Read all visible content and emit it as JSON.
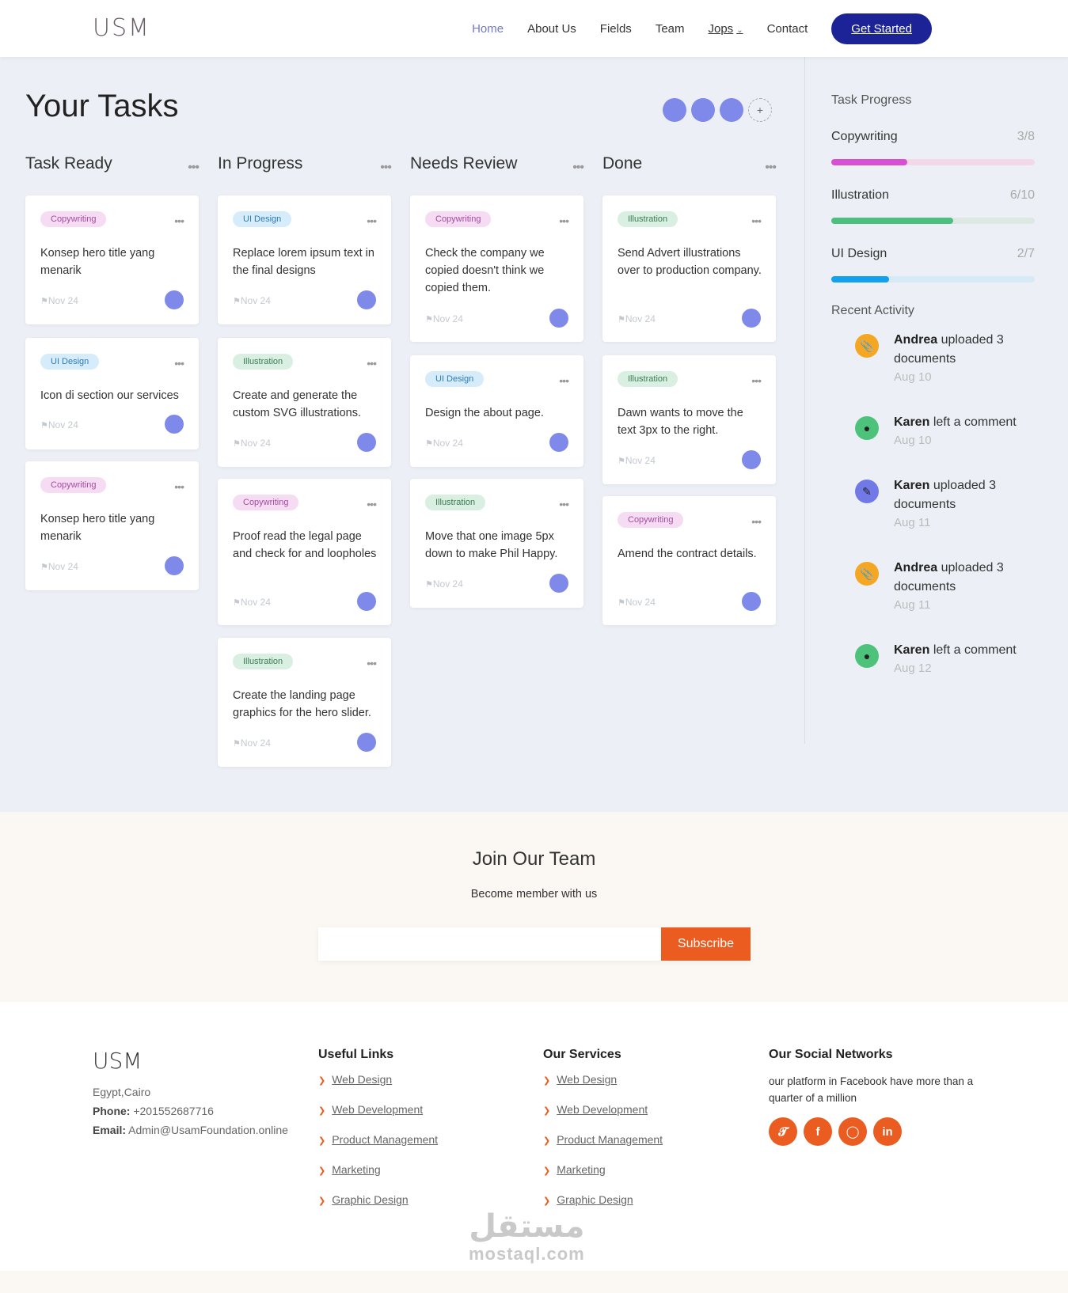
{
  "header": {
    "logo": "USM",
    "nav": [
      "Home",
      "About Us",
      "Fields",
      "Team",
      "Jops",
      "Contact"
    ],
    "cta": "Get Started"
  },
  "tasks": {
    "title": "Your Tasks",
    "add_symbol": "+",
    "columns": [
      {
        "title": "Task Ready",
        "cards": [
          {
            "tag": "Copywriting",
            "text": "Konsep hero title yang menarik",
            "date": "Nov 24"
          },
          {
            "tag": "UI Design",
            "text": "Icon di section our services",
            "date": "Nov 24"
          },
          {
            "tag": "Copywriting",
            "text": "Konsep hero title yang menarik",
            "date": "Nov 24"
          }
        ]
      },
      {
        "title": "In Progress",
        "cards": [
          {
            "tag": "UI Design",
            "text": "Replace lorem ipsum text in the final designs",
            "date": "Nov 24"
          },
          {
            "tag": "Illustration",
            "text": "Create and generate the custom SVG illustrations.",
            "date": "Nov 24"
          },
          {
            "tag": "Copywriting",
            "text": "Proof read the legal page and check for and loopholes",
            "date": "Nov 24"
          },
          {
            "tag": "Illustration",
            "text": "Create the landing page graphics for the hero slider.",
            "date": "Nov 24"
          }
        ]
      },
      {
        "title": "Needs Review",
        "cards": [
          {
            "tag": "Copywriting",
            "text": "Check the company we copied doesn't think we copied them.",
            "date": "Nov 24"
          },
          {
            "tag": "UI Design",
            "text": "Design the about page.",
            "date": "Nov 24"
          },
          {
            "tag": "Illustration",
            "text": "Move that one image 5px down to make Phil Happy.",
            "date": "Nov 24"
          }
        ]
      },
      {
        "title": "Done",
        "cards": [
          {
            "tag": "Illustration",
            "text": "Send Advert illustrations over to production company.",
            "date": "Nov 24"
          },
          {
            "tag": "Illustration",
            "text": "Dawn wants to move the text 3px to the right.",
            "date": "Nov 24"
          },
          {
            "tag": "Copywriting",
            "text": "Amend the contract details.",
            "date": "Nov 24"
          }
        ]
      }
    ]
  },
  "sidebar": {
    "progress_title": "Task Progress",
    "progress": [
      {
        "label": "Copywriting",
        "count": "3/8",
        "fraction": 0.375,
        "color": "#d94fd3",
        "track": "#f3d8ea"
      },
      {
        "label": "Illustration",
        "count": "6/10",
        "fraction": 0.6,
        "color": "#4cbf7f",
        "track": "#dde8e2"
      },
      {
        "label": "UI Design",
        "count": "2/7",
        "fraction": 0.2857,
        "color": "#12a0f0",
        "track": "#d6e9f6"
      }
    ],
    "activity_title": "Recent Activity",
    "activity": [
      {
        "name": "Andrea",
        "action": "uploaded 3 documents",
        "date": "Aug 10",
        "icon": "paperclip-icon",
        "color": "#f5a623"
      },
      {
        "name": "Karen",
        "action": "left a comment",
        "date": "Aug 10",
        "icon": "comment-icon",
        "color": "#4cc27a"
      },
      {
        "name": "Karen",
        "action": "uploaded 3 documents",
        "date": "Aug 11",
        "icon": "pencil-icon",
        "color": "#7179e6"
      },
      {
        "name": "Andrea",
        "action": "uploaded 3 documents",
        "date": "Aug 11",
        "icon": "paperclip-icon",
        "color": "#f5a623"
      },
      {
        "name": "Karen",
        "action": "left a comment",
        "date": "Aug 12",
        "icon": "comment-icon",
        "color": "#4cc27a"
      }
    ]
  },
  "join": {
    "title": "Join Our Team",
    "subtitle": "Become member with us",
    "button": "Subscribe"
  },
  "footer": {
    "logo": "USM",
    "address": "Egypt,Cairo",
    "phone_label": "Phone:",
    "phone": "+201552687716",
    "email_label": "Email:",
    "email": "Admin@UsamFoundation.online",
    "useful_title": "Useful Links",
    "useful_links": [
      "Web Design",
      "Web Development",
      "Product Management",
      "Marketing",
      "Graphic Design"
    ],
    "services_title": "Our Services",
    "services_links": [
      "Web Design",
      "Web Development",
      "Product Management",
      "Marketing",
      "Graphic Design"
    ],
    "social_title": "Our Social Networks",
    "social_text": "our platform in Facebook have more than a quarter of a million",
    "social_icons": [
      "twitter-icon",
      "facebook-icon",
      "instagram-icon",
      "linkedin-icon"
    ]
  },
  "watermark": {
    "arabic": "مستقل",
    "latin": "mostaql.com"
  }
}
